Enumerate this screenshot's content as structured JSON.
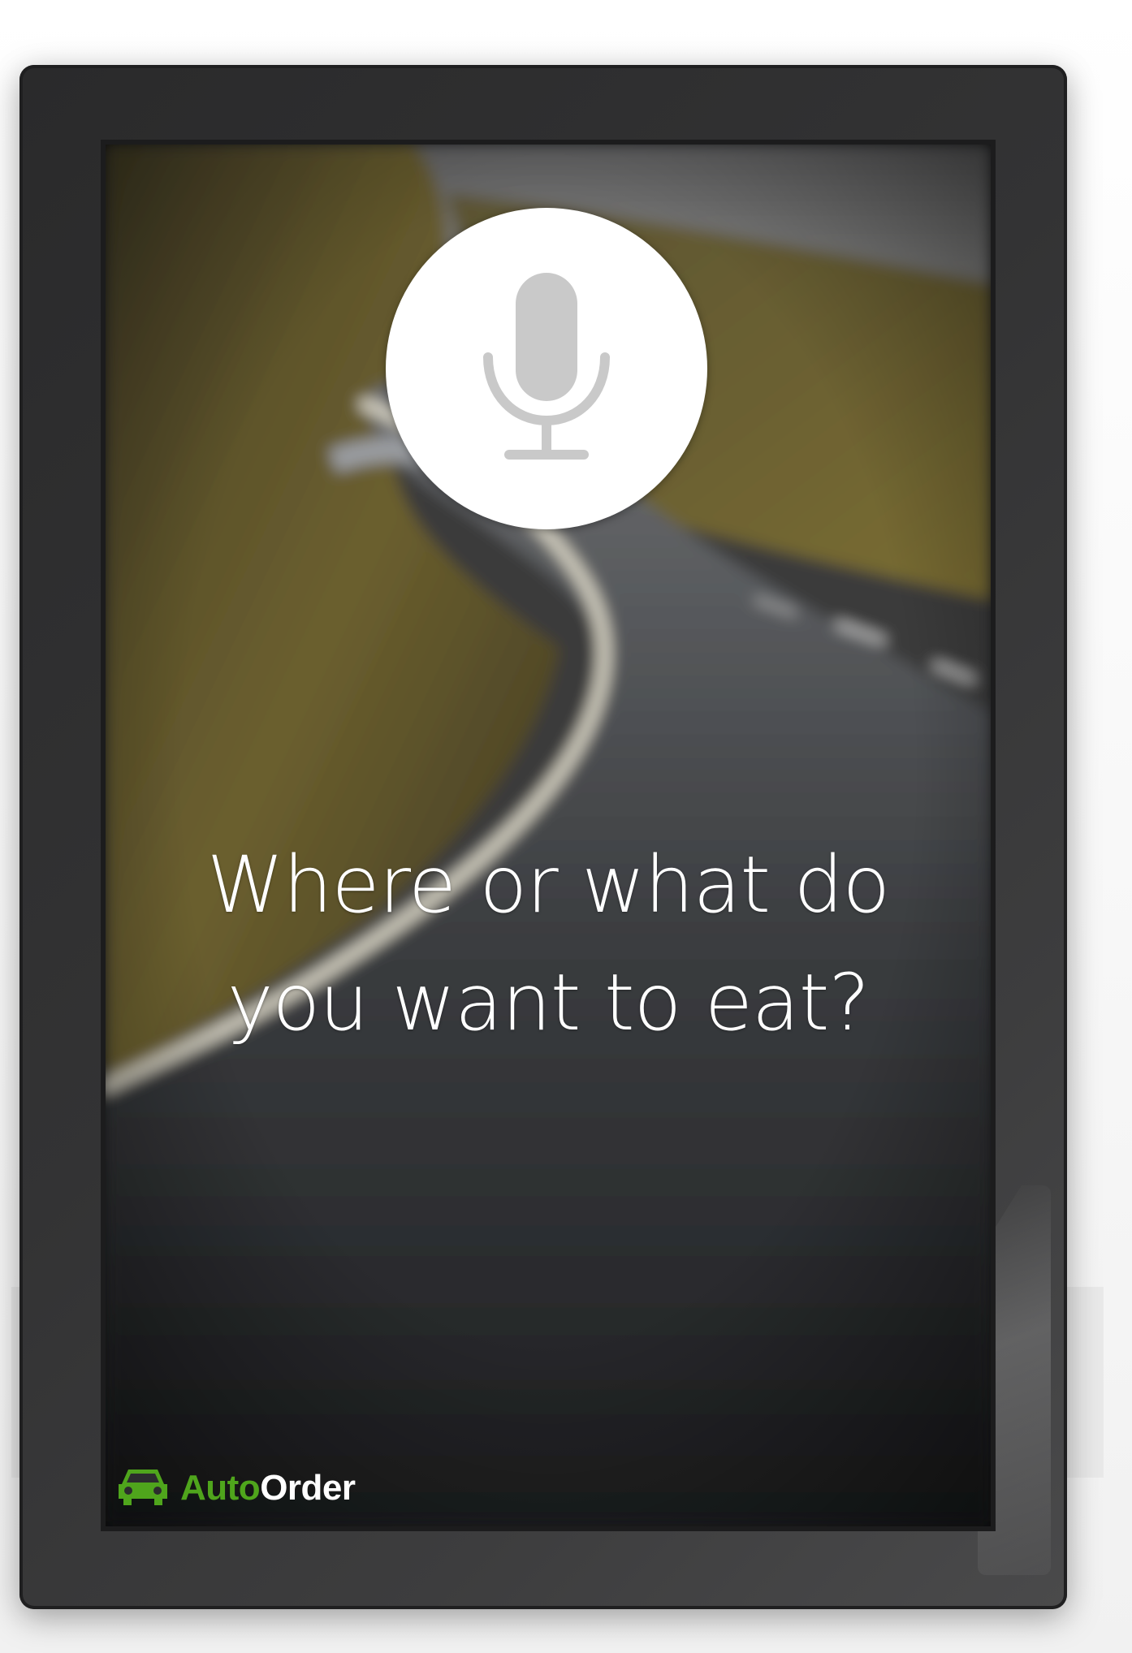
{
  "prompt": {
    "line1": "Where or what do",
    "line2": "you want to eat?"
  },
  "mic": {
    "icon": "microphone-icon",
    "color": "#c9c9c9"
  },
  "brand": {
    "icon": "car-icon",
    "part1": "Auto",
    "part2": "Order",
    "accent_color": "#4fa51c"
  }
}
